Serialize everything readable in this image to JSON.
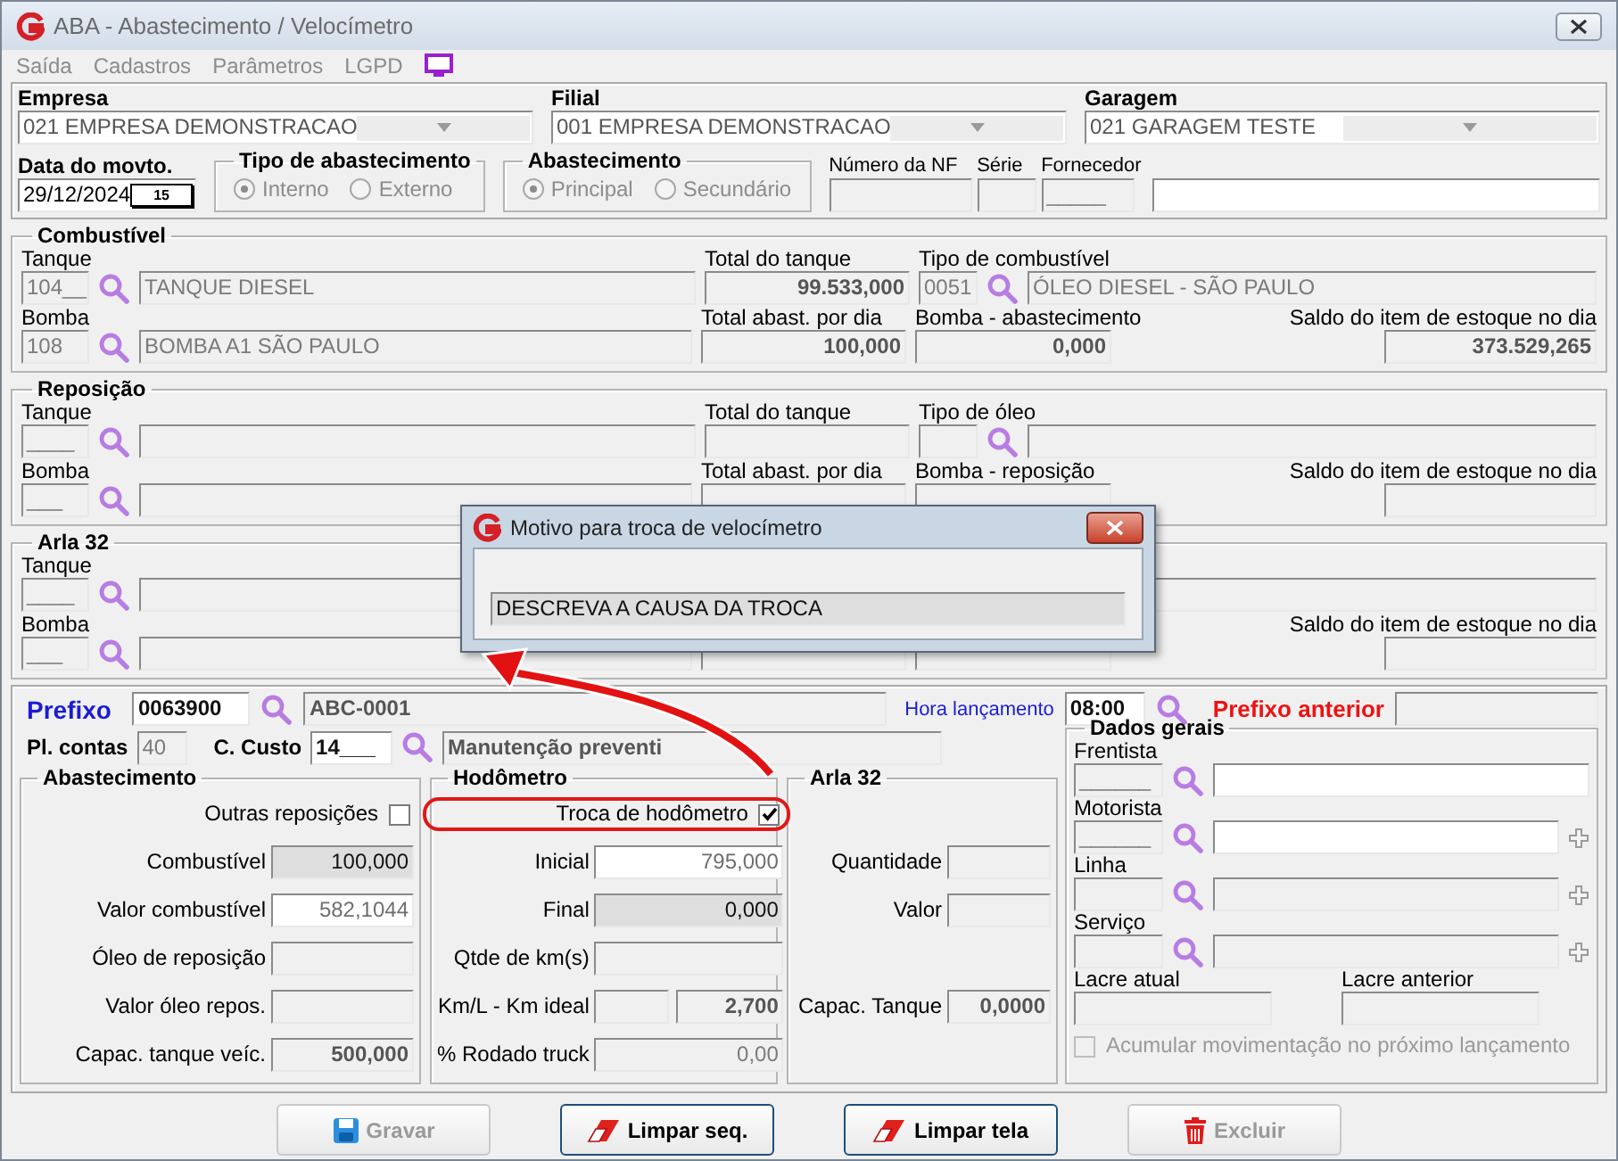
{
  "window": {
    "title": "ABA - Abastecimento / Velocímetro"
  },
  "menu": [
    {
      "label": "Saída",
      "disabled": true
    },
    {
      "label": "Cadastros",
      "disabled": true
    },
    {
      "label": "Parâmetros",
      "disabled": true
    },
    {
      "label": "LGPD",
      "disabled": true
    }
  ],
  "header": {
    "selects": [
      {
        "label": "Empresa",
        "value": "021 EMPRESA DEMONSTRACAO"
      },
      {
        "label": "Filial",
        "value": "001 EMPRESA DEMONSTRACAO"
      },
      {
        "label": "Garagem",
        "value": "021 GARAGEM TESTE"
      }
    ],
    "date": {
      "label": "Data do movto.",
      "value": "29/12/2024",
      "calendar": "15"
    },
    "radio_groups": [
      {
        "title": "Tipo de abastecimento",
        "options": [
          {
            "label": "Interno",
            "selected": true
          },
          {
            "label": "Externo",
            "selected": false
          }
        ]
      },
      {
        "title": "Abastecimento",
        "options": [
          {
            "label": "Principal",
            "selected": true
          },
          {
            "label": "Secundário",
            "selected": false
          }
        ]
      }
    ],
    "small_fields": [
      {
        "label": "Número da NF",
        "kind": "disabled"
      },
      {
        "label": "Série",
        "kind": "disabled"
      },
      {
        "label": "Fornecedor",
        "value": "_____",
        "kind": "disabled"
      }
    ],
    "extra_field": {
      "kind": "editable"
    }
  },
  "sections": [
    {
      "title": "Combustível",
      "row_1": {
        "label": "Tanque",
        "code": {
          "value": "104__",
          "kind": "disabled"
        },
        "description": {
          "value": "TANQUE DIESEL",
          "kind": "disabled"
        },
        "total_label": "Total do tanque",
        "total": {
          "value": "99.533,000",
          "kind": "readonly"
        },
        "type_label": "Tipo de combustível",
        "type_code": {
          "value": "0051",
          "kind": "disabled"
        },
        "type_description": {
          "value": "ÓLEO DIESEL - SÃO PAULO",
          "kind": "disabled"
        }
      },
      "row_2": {
        "label": "Bomba",
        "code": {
          "value": "108",
          "kind": "disabled"
        },
        "description": {
          "value": "BOMBA A1 SÃO PAULO",
          "kind": "disabled"
        },
        "total_label": "Total abast. por dia",
        "total": {
          "value": "100,000",
          "kind": "readonly"
        },
        "pump_label": "Bomba - abastecimento",
        "pump": {
          "value": "0,000",
          "kind": "readonly"
        },
        "balance_label": "Saldo do item de estoque no dia",
        "balance": {
          "value": "373.529,265",
          "kind": "readonly"
        }
      }
    },
    {
      "title": "Reposição",
      "row_1": {
        "label": "Tanque",
        "code": {
          "value": "____",
          "kind": "disabled"
        },
        "description": {
          "kind": "disabled"
        },
        "total_label": "Total do tanque",
        "total": {
          "kind": "readonly"
        },
        "type_label": "Tipo de óleo",
        "type_code": {
          "kind": "disabled"
        },
        "type_description": {
          "kind": "disabled"
        }
      },
      "row_2": {
        "label": "Bomba",
        "code": {
          "value": "___",
          "kind": "disabled"
        },
        "description": {
          "kind": "disabled"
        },
        "total_label": "Total abast. por dia",
        "total": {
          "kind": "readonly"
        },
        "pump_label": "Bomba - reposição",
        "pump": {
          "kind": "readonly"
        },
        "balance_label": "Saldo do item de estoque no dia",
        "balance": {
          "kind": "readonly"
        }
      }
    },
    {
      "title": "Arla 32",
      "row_1": {
        "label": "Tanque",
        "code": {
          "value": "____",
          "kind": "disabled"
        },
        "description": {
          "kind": "disabled"
        },
        "type_description": {
          "kind": "disabled"
        }
      },
      "row_2": {
        "label": "Bomba",
        "code": {
          "value": "___",
          "kind": "disabled"
        },
        "description": {
          "kind": "disabled"
        },
        "total": {
          "kind": "readonly"
        },
        "pump": {
          "kind": "readonly"
        },
        "balance_label": "Saldo do item de estoque no dia",
        "balance": {
          "kind": "readonly"
        }
      }
    }
  ],
  "vehicle": {
    "prefix_label": "Prefixo",
    "prefix": {
      "value": "0063900",
      "kind": "entry"
    },
    "prefix_description": {
      "value": "ABC-0001",
      "kind": "readonly"
    },
    "time_label": "Hora lançamento",
    "time": {
      "value": "08:00",
      "kind": "entry"
    },
    "previous_label": "Prefixo anterior",
    "previous": {
      "kind": "disabled"
    },
    "account_label": "Pl. contas",
    "account": {
      "value": "40",
      "kind": "disabled"
    },
    "cost_label": "C. Custo",
    "cost": {
      "value": "14___",
      "kind": "entry"
    },
    "cost_description": {
      "value": "Manutenção preventi",
      "kind": "readonly"
    }
  },
  "groups": [
    {
      "title": "Abastecimento",
      "check": {
        "label": "Outras reposições",
        "checked": false
      },
      "rows": [
        {
          "label": "Combustível",
          "fields": [
            {
              "value": "100,000",
              "kind": "shaded"
            }
          ]
        },
        {
          "label": "Valor combustível",
          "fields": [
            {
              "value": "582,1044",
              "kind": "editable"
            }
          ]
        },
        {
          "label": "Óleo de reposição",
          "fields": [
            {
              "kind": "disabled"
            }
          ]
        },
        {
          "label": "Valor óleo repos.",
          "fields": [
            {
              "kind": "disabled"
            }
          ]
        },
        {
          "label": "Capac. tanque veíc.",
          "fields": [
            {
              "value": "500,000",
              "kind": "readonly"
            }
          ]
        }
      ]
    },
    {
      "title": "Hodômetro",
      "check": {
        "label": "Troca de hodômetro",
        "checked": true,
        "highlighted": true
      },
      "rows": [
        {
          "label": "Inicial",
          "fields": [
            {
              "value": "795,000",
              "kind": "editable"
            }
          ]
        },
        {
          "label": "Final",
          "fields": [
            {
              "value": "0,000",
              "kind": "shaded"
            }
          ]
        },
        {
          "label": "Qtde de km(s)",
          "fields": [
            {
              "kind": "disabled"
            }
          ]
        },
        {
          "label": "Km/L - Km ideal",
          "fields": [
            {
              "kind": "disabled"
            },
            {
              "value": "2,700",
              "kind": "readonly"
            }
          ]
        },
        {
          "label": "% Rodado truck",
          "fields": [
            {
              "value": "0,00",
              "kind": "disabled"
            }
          ]
        }
      ]
    },
    {
      "title": "Arla 32",
      "rows": [
        {
          "label": "Quantidade",
          "fields": [
            {
              "kind": "disabled"
            }
          ]
        },
        {
          "label": "Valor",
          "fields": [
            {
              "kind": "disabled"
            }
          ]
        },
        {
          "label": "Capac. Tanque",
          "fields": [
            {
              "value": "0,0000",
              "kind": "readonly"
            }
          ]
        }
      ]
    }
  ],
  "general": {
    "title": "Dados gerais",
    "rows": [
      {
        "label": "Frentista",
        "code": {
          "value": "______",
          "kind": "disabled"
        },
        "description": {
          "kind": "editable"
        },
        "add": false
      },
      {
        "label": "Motorista",
        "code": {
          "value": "______",
          "kind": "disabled"
        },
        "description": {
          "kind": "editable"
        },
        "add": true
      },
      {
        "label": "Linha",
        "code": {
          "kind": "disabled"
        },
        "description": {
          "kind": "disabled"
        },
        "add": true
      },
      {
        "label": "Serviço",
        "code": {
          "kind": "disabled"
        },
        "description": {
          "kind": "disabled"
        },
        "add": true
      }
    ],
    "seals": [
      {
        "label": "Lacre atual",
        "kind": "disabled"
      },
      {
        "label": "Lacre anterior",
        "kind": "disabled"
      }
    ],
    "check": {
      "label": "Acumular movimentação no próximo lançamento",
      "checked": false,
      "disabled": true
    }
  },
  "buttons": [
    {
      "label": "Gravar",
      "kind": "save",
      "disabled": true
    },
    {
      "label": "Limpar seq.",
      "kind": "eraser",
      "disabled": false
    },
    {
      "label": "Limpar tela",
      "kind": "eraser",
      "disabled": false
    },
    {
      "label": "Excluir",
      "kind": "trash",
      "disabled": true
    }
  ],
  "dialog": {
    "title": "Motivo para troca de velocímetro",
    "field": {
      "value": "DESCREVA A CAUSA DA TROCA",
      "kind": "shaded"
    }
  }
}
